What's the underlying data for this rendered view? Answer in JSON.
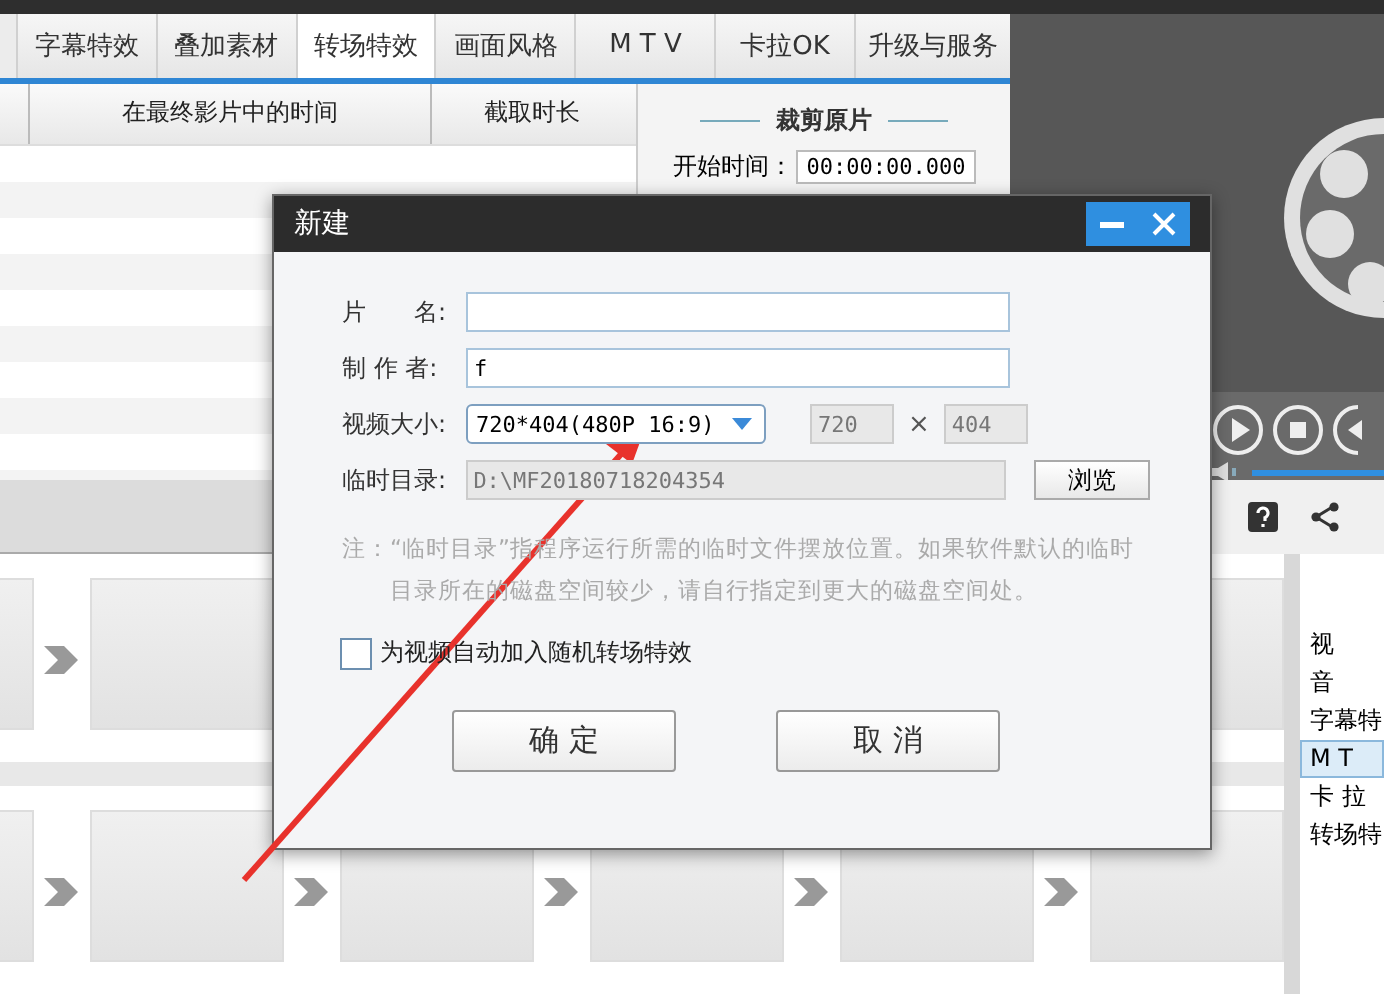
{
  "tabs": [
    {
      "label": "字幕特效",
      "selected": false
    },
    {
      "label": "叠加素材",
      "selected": false
    },
    {
      "label": "转场特效",
      "selected": true
    },
    {
      "label": "画面风格",
      "selected": false
    },
    {
      "label": "M T V",
      "selected": false
    },
    {
      "label": "卡拉OK",
      "selected": false
    },
    {
      "label": "升级与服务",
      "selected": false
    }
  ],
  "table": {
    "columns": [
      "在最终影片中的时间",
      "截取时长"
    ]
  },
  "cut_panel": {
    "title": "裁剪原片",
    "start_label": "开始时间：",
    "start_value": "00:00:00.000"
  },
  "player": {
    "volume": {
      "level": 1
    }
  },
  "side_list": {
    "items": [
      {
        "label": "视",
        "selected": false
      },
      {
        "label": "音",
        "selected": false
      },
      {
        "label": "字幕特",
        "selected": false
      },
      {
        "label": "M  T",
        "selected": true
      },
      {
        "label": "卡 拉",
        "selected": false
      },
      {
        "label": "转场特",
        "selected": false
      }
    ]
  },
  "dialog": {
    "title": "新建",
    "name_label": "片　　名:",
    "author_label": "制 作 者:",
    "author_value": "f",
    "size_label": "视频大小:",
    "size_value": "720*404(480P 16:9)",
    "width_value": "720",
    "times": "×",
    "height_value": "404",
    "dir_label": "临时目录:",
    "dir_value": "D:\\MF20180718204354",
    "browse": "浏览",
    "note_label": "注：",
    "note": "“临时目录”指程序运行所需的临时文件摆放位置。如果软件默认的临时目录所在的磁盘空间较少，请自行指定到更大的磁盘空间处。",
    "checkbox": {
      "label": "为视频自动加入随机转场特效",
      "checked": false
    },
    "buttons": [
      "确 定",
      "取 消"
    ]
  }
}
